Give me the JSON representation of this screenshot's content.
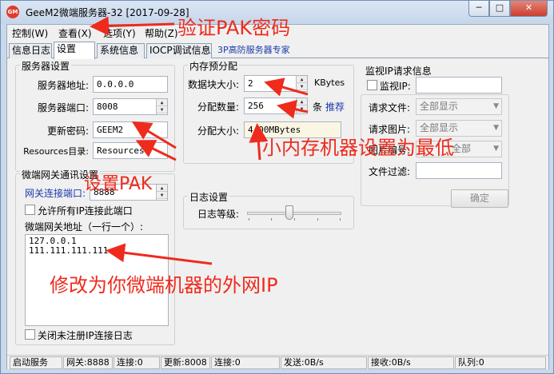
{
  "window": {
    "title": "GeeM2微端服务器-32 [2017-09-28]",
    "icon": "app-logo-icon",
    "min": "─",
    "max": "□",
    "close": "✕"
  },
  "menu": [
    "控制(W)",
    "查看(X)",
    "选项(Y)",
    "帮助(Z)"
  ],
  "tabs": [
    "信息日志",
    "设置",
    "系统信息",
    "IOCP调试信息"
  ],
  "tab_link": "3P高防服务器专家",
  "server": {
    "title": "服务器设置",
    "addr_label": "服务器地址:",
    "addr": "0.0.0.0",
    "port_label": "服务器端口:",
    "port": "8008",
    "pwd_label": "更新密码:",
    "pwd": "GEEM2",
    "res_label": "Resources目录:",
    "res": "Resources"
  },
  "gateway": {
    "title": "微端网关通讯设置",
    "port_label": "网关连接端口:",
    "port": "8888",
    "allow_all": "允许所有IP连接此端口",
    "addr_label": "微端网关地址（一行一个）:",
    "addrs": [
      "127.0.0.1",
      "111.111.111.111"
    ],
    "close_log": "关闭未注册IP连接日志"
  },
  "memory": {
    "title": "内存预分配",
    "block_label": "数据块大小:",
    "block": "2",
    "block_unit": "KBytes",
    "count_label": "分配数量:",
    "count": "256",
    "count_unit": "条",
    "recommend": "推荐",
    "size_label": "分配大小:",
    "size": "4.00MBytes"
  },
  "log": {
    "title": "日志设置",
    "level_label": "日志等级:",
    "level": 0.45
  },
  "monitor": {
    "title": "监视IP请求信息",
    "ip_label": "监视IP:",
    "req_file_label": "请求文件:",
    "req_file": "全部显示",
    "req_img_label": "请求图片:",
    "req_img": "全部显示",
    "img_num_label": "图片编号:",
    "img_num": "全部",
    "file_filter_label": "文件过滤:",
    "confirm": "确定"
  },
  "status": {
    "start": "启动服务",
    "gw": "网关:8888",
    "gw_conn": "连接:0",
    "upd": "更新:8008",
    "upd_conn": "连接:0",
    "send": "发送:0B/s",
    "recv": "接收:0B/s",
    "queue": "队列:0"
  },
  "annotations": {
    "pak_pwd": "验证PAK密码",
    "set_pak": "设置PAK",
    "mem": "小内存机器设置为最低",
    "ip": "修改为你微端机器的外网IP",
    "color": "#ee2b1d"
  }
}
